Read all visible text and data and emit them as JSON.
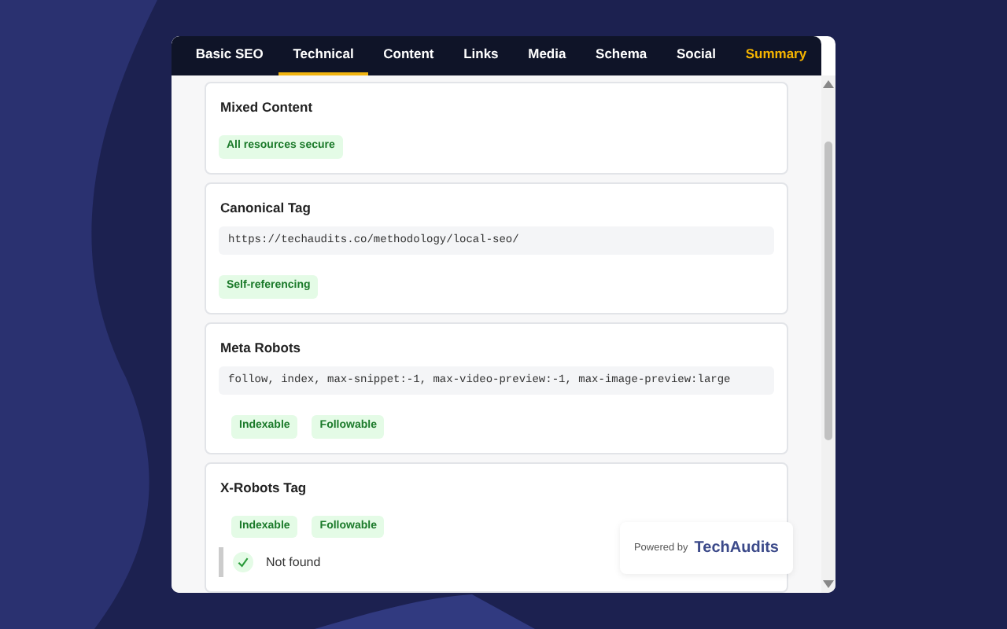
{
  "tabs": [
    {
      "label": "Basic SEO",
      "selected": false,
      "highlighted": false
    },
    {
      "label": "Technical",
      "selected": true,
      "highlighted": false
    },
    {
      "label": "Content",
      "selected": false,
      "highlighted": false
    },
    {
      "label": "Links",
      "selected": false,
      "highlighted": false
    },
    {
      "label": "Media",
      "selected": false,
      "highlighted": false
    },
    {
      "label": "Schema",
      "selected": false,
      "highlighted": false
    },
    {
      "label": "Social",
      "selected": false,
      "highlighted": false
    },
    {
      "label": "Summary",
      "selected": false,
      "highlighted": true
    }
  ],
  "sections": [
    {
      "title": "Mixed Content",
      "badges": [
        "All resources secure"
      ]
    },
    {
      "title": "Canonical Tag",
      "code": "https://techaudits.co/methodology/local-seo/",
      "badges": [
        "Self-referencing"
      ]
    },
    {
      "title": "Meta Robots",
      "code": "follow, index, max-snippet:-1, max-video-preview:-1, max-image-preview:large",
      "badges": [
        "Indexable",
        "Followable"
      ],
      "indent_badges": true
    },
    {
      "title": "X-Robots Tag",
      "badges": [
        "Indexable",
        "Followable"
      ],
      "indent_badges": true,
      "result": {
        "text": "Not found",
        "passed": true
      }
    }
  ],
  "powered_by": {
    "prefix": "Powered by",
    "brand": "TechAudits"
  }
}
